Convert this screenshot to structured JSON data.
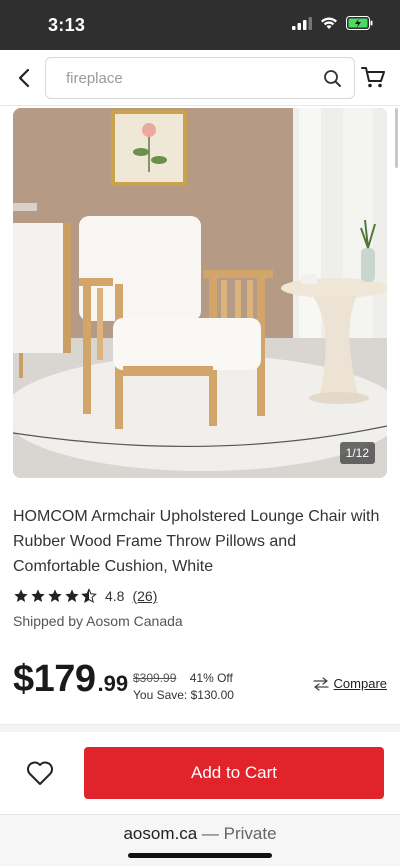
{
  "status_bar": {
    "time": "3:13"
  },
  "search": {
    "placeholder": "fireplace"
  },
  "product": {
    "image_counter": "1/12",
    "title": "HOMCOM Armchair Upholstered Lounge Chair with Rubber Wood Frame Throw Pillows and Comfortable Cushion, White",
    "rating": "4.8",
    "stars": 4.5,
    "review_count": "(26)",
    "shipped_by": "Shipped by Aosom Canada"
  },
  "price": {
    "main": "$179",
    "cents": ".99",
    "original": "$309.99",
    "discount": "41% Off",
    "savings": "You Save: $130.00"
  },
  "compare_label": "Compare",
  "actions": {
    "add_to_cart": "Add to Cart"
  },
  "browser": {
    "domain": "aosom.ca",
    "mode": "— Private"
  },
  "colors": {
    "accent": "#e1232c",
    "status_bar": "#2f2f2f"
  }
}
